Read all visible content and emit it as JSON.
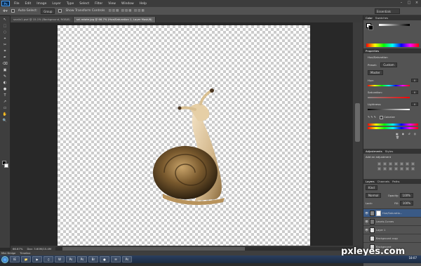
{
  "menu": {
    "logo": "Ps",
    "items": [
      "File",
      "Edit",
      "Image",
      "Layer",
      "Type",
      "Select",
      "Filter",
      "View",
      "Window",
      "Help"
    ],
    "window_controls": [
      "–",
      "□",
      "×"
    ]
  },
  "options": {
    "auto_select_label": "Auto-Select:",
    "auto_select_value": "Group",
    "transform_label": "Show Transform Controls",
    "workspace": "Essentials"
  },
  "tools": [
    "↖",
    "⬚",
    "◌",
    "⌖",
    "✂",
    "⌗",
    "✒",
    "⌫",
    "▣",
    "✎",
    "◐",
    "●",
    "T",
    "↗",
    "▭",
    "✋",
    "🔍"
  ],
  "tabs": [
    {
      "label": "snailx1.psd @ 15.1% (Background, RGB/8)",
      "active": false
    },
    {
      "label": "snl-rotate.jpg @ 66.7% (Hue/Saturation 1, Layer Mask/8)",
      "active": true
    }
  ],
  "status": {
    "zoom": "66.67%",
    "doc": "Doc: 3.60M/15.4M"
  },
  "mini_bridge": [
    "Mini Bridge",
    "Timeline"
  ],
  "taskbar": {
    "apps": [
      "IE",
      "📁",
      "▶",
      "♫",
      "W",
      "Ps",
      "Ps",
      "Br",
      "●",
      "✉",
      "Ps"
    ],
    "time": "18:07",
    "date": "22/01/2014"
  },
  "watermark": "pxleyes.com",
  "panels": {
    "color_tabs": [
      "Color",
      "Swatches"
    ],
    "properties_title": "Properties",
    "hue_sat_title": "Hue/Saturation",
    "preset_label": "Preset:",
    "preset_value": "Custom",
    "channel_value": "Master",
    "hue_label": "Hue:",
    "hue_value": "0",
    "saturation_label": "Saturation:",
    "saturation_value": "0",
    "lightness_label": "Lightness:",
    "lightness_value": "0",
    "colorize_label": "Colorize",
    "adj_tabs": [
      "Adjustments",
      "Styles"
    ],
    "add_adjustment_label": "Add an adjustment",
    "layers_tabs": [
      "Layers",
      "Channels",
      "Paths"
    ],
    "kind_label": "Kind",
    "blend_mode": "Normal",
    "opacity_label": "Opacity:",
    "opacity_value": "100%",
    "lock_label": "Lock:",
    "fill_label": "Fill:",
    "fill_value": "100%",
    "layers": [
      {
        "name": "Hue/Saturatio...",
        "selected": true,
        "visible": true
      },
      {
        "name": "Levels-Curves",
        "selected": false,
        "visible": true
      },
      {
        "name": "Layer 1",
        "selected": false,
        "visible": true
      },
      {
        "name": "Background copy",
        "selected": false,
        "visible": false
      },
      {
        "name": "Background",
        "selected": false,
        "visible": false
      }
    ]
  }
}
